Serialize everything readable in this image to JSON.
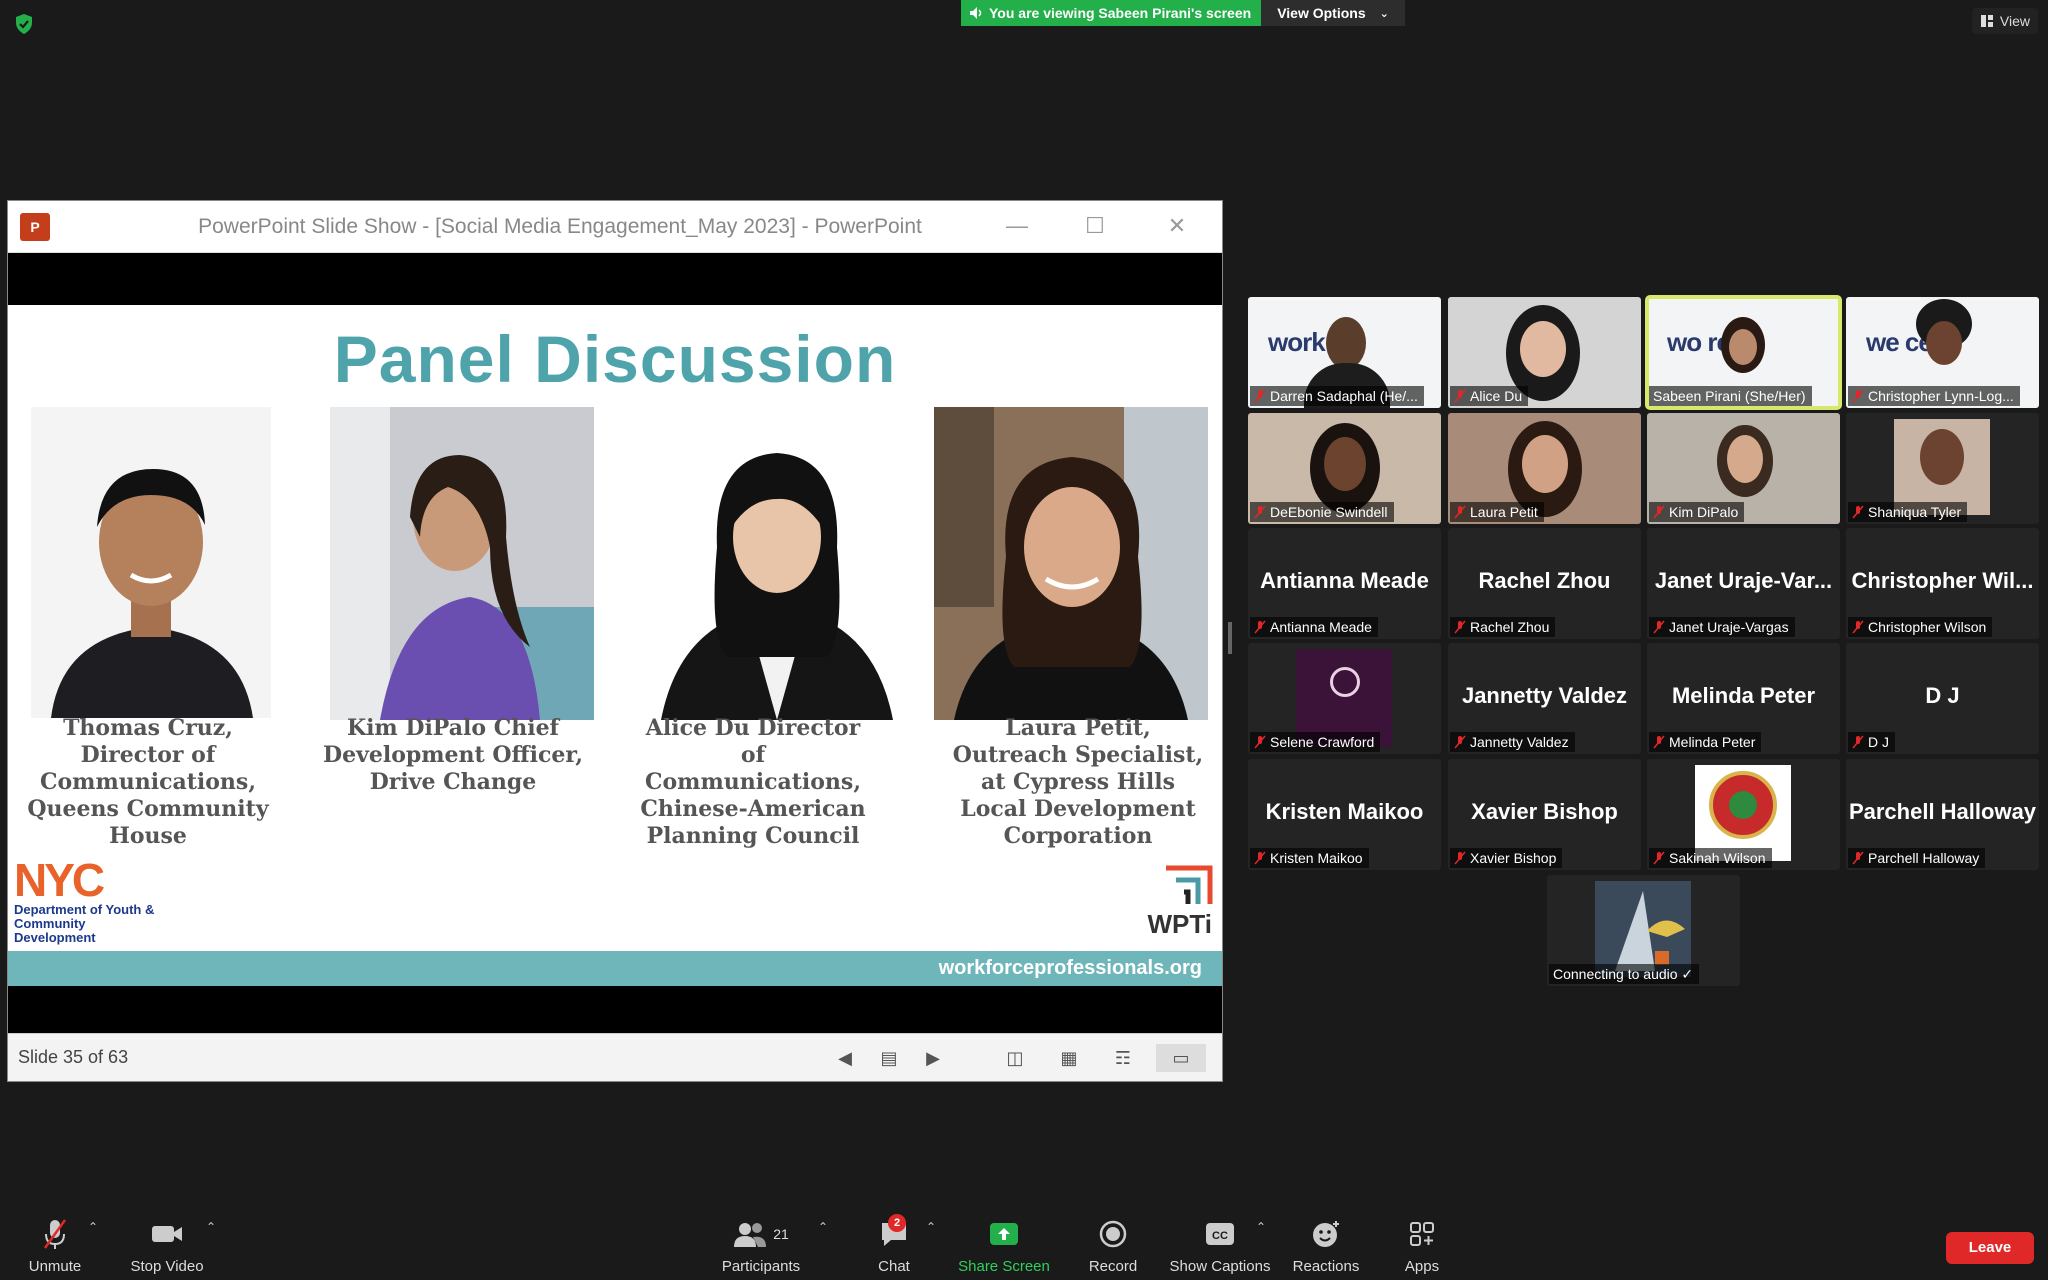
{
  "top": {
    "viewing_text": "You are viewing Sabeen Pirani's screen",
    "view_options": "View Options",
    "view_button": "View"
  },
  "ppt": {
    "window_title": "PowerPoint Slide Show - [Social Media Engagement_May 2023] - PowerPoint",
    "logo_text": "P",
    "slide_counter": "Slide 35 of 63",
    "slide": {
      "title": "Panel Discussion",
      "panelists": [
        {
          "caption": "Thomas Cruz, Director of Communications, Queens Community House"
        },
        {
          "caption": "Kim DiPalo Chief Development Officer, Drive Change"
        },
        {
          "caption": "Alice Du Director of Communications, Chinese-American Planning Council"
        },
        {
          "caption": "Laura Petit, Outreach Specialist, at Cypress Hills Local Development Corporation"
        }
      ],
      "nyc_mark": "NYC",
      "dycd_text": "Department of Youth & Community Development",
      "wpti_label": "WPTi",
      "url": "workforceprofessionals.org"
    }
  },
  "gallery": {
    "tiles": [
      {
        "name": "Darren Sadaphal (He/...",
        "kind": "video-wp"
      },
      {
        "name": "Alice Du",
        "kind": "video"
      },
      {
        "name": "Sabeen Pirani (She/Her)",
        "kind": "video-wp",
        "active": true
      },
      {
        "name": "Christopher Lynn-Log...",
        "kind": "video-wp"
      },
      {
        "name": "DeEbonie Swindell",
        "kind": "video"
      },
      {
        "name": "Laura Petit",
        "kind": "video"
      },
      {
        "name": "Kim DiPalo",
        "kind": "video"
      },
      {
        "name": "Shaniqua Tyler",
        "kind": "photo"
      },
      {
        "name": "Antianna Meade",
        "big": "Antianna Meade",
        "kind": "text"
      },
      {
        "name": "Rachel Zhou",
        "big": "Rachel Zhou",
        "kind": "text"
      },
      {
        "name": "Janet Uraje-Vargas",
        "big": "Janet  Uraje-Var...",
        "kind": "text"
      },
      {
        "name": "Christopher Wilson",
        "big": "Christopher  Wil...",
        "kind": "text"
      },
      {
        "name": "Selene Crawford",
        "kind": "photo"
      },
      {
        "name": "Jannetty Valdez",
        "big": "Jannetty Valdez",
        "kind": "text"
      },
      {
        "name": "Melinda Peter",
        "big": "Melinda Peter",
        "kind": "text"
      },
      {
        "name": "D J",
        "big": "D J",
        "kind": "text"
      },
      {
        "name": "Kristen Maikoo",
        "big": "Kristen Maikoo",
        "kind": "text"
      },
      {
        "name": "Xavier Bishop",
        "big": "Xavier Bishop",
        "kind": "text"
      },
      {
        "name": "Sakinah Wilson",
        "kind": "photo"
      },
      {
        "name": "Parchell Halloway",
        "big": "Parchell Halloway",
        "kind": "text"
      },
      {
        "name": "Connecting to audio ✓",
        "kind": "photo",
        "connecting": true
      }
    ]
  },
  "toolbar": {
    "unmute": "Unmute",
    "stop_video": "Stop Video",
    "participants": "Participants",
    "participants_count": "21",
    "chat": "Chat",
    "chat_badge": "2",
    "share_screen": "Share Screen",
    "record": "Record",
    "show_captions": "Show Captions",
    "reactions": "Reactions",
    "apps": "Apps",
    "leave": "Leave"
  },
  "colors": {
    "accent_green": "#23b04b",
    "leave_red": "#e02828",
    "active_speaker": "#d8e86b",
    "slide_title": "#4fa3aa"
  }
}
